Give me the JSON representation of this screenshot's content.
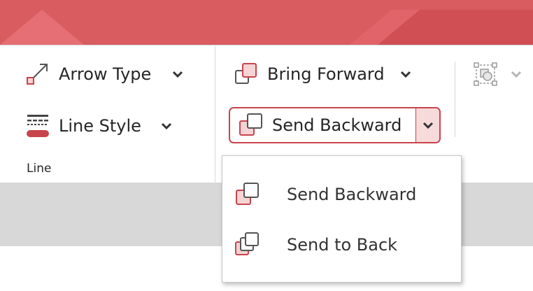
{
  "ribbon": {
    "line_group": {
      "arrow_type_label": "Arrow Type",
      "line_style_label": "Line Style",
      "group_label": "Line"
    },
    "arrange_group": {
      "bring_forward_label": "Bring Forward",
      "send_backward_label": "Send Backward"
    }
  },
  "send_backward_menu": {
    "items": [
      {
        "label": "Send Backward",
        "icon": "send-backward-icon"
      },
      {
        "label": "Send to Back",
        "icon": "send-to-back-icon"
      }
    ]
  },
  "colors": {
    "accent": "#c8444d",
    "title_band": "#d95c61",
    "icon_fill": "#f7d4d4",
    "gray_band": "#d8d8d8"
  }
}
